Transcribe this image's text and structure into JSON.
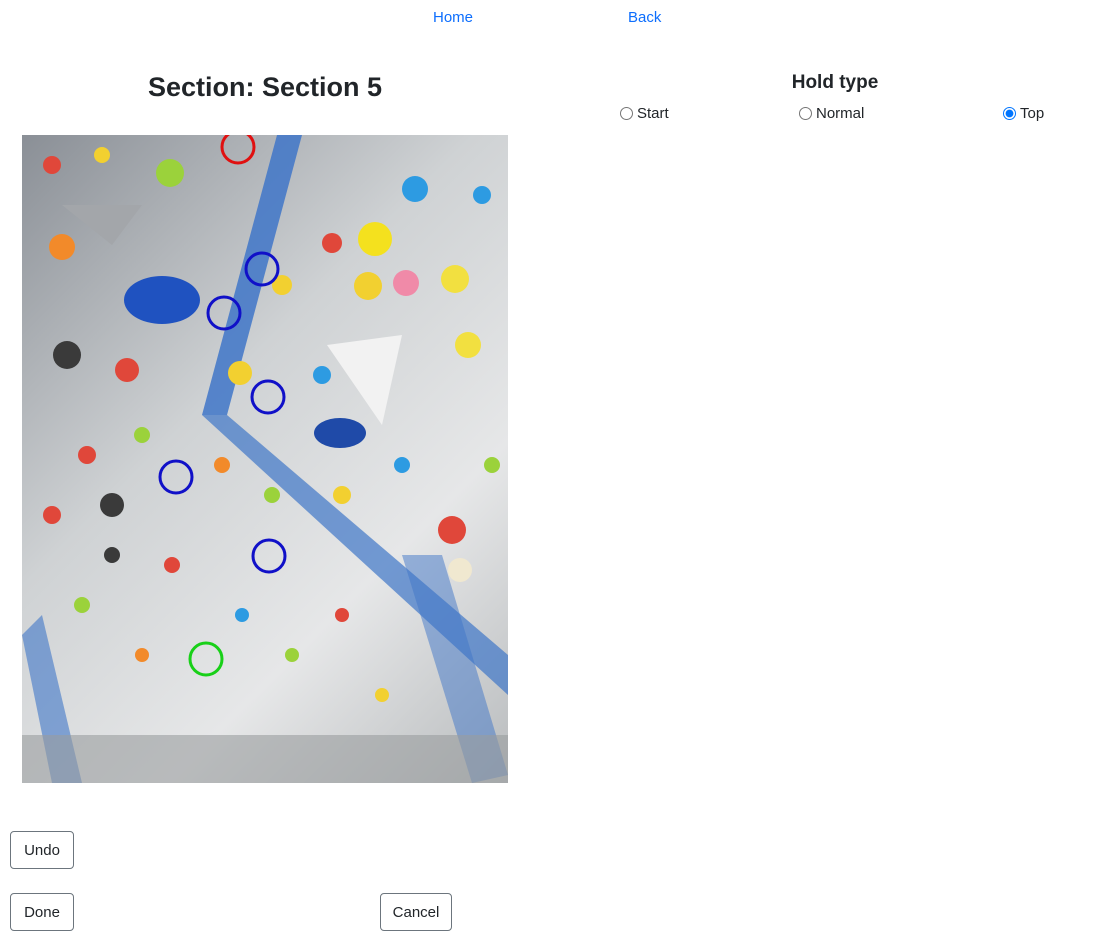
{
  "nav": {
    "home": "Home",
    "back": "Back"
  },
  "section_title": "Section: Section 5",
  "hold_type": {
    "title": "Hold type",
    "options": [
      {
        "label": "Start",
        "checked": false
      },
      {
        "label": "Normal",
        "checked": false
      },
      {
        "label": "Top",
        "checked": true
      }
    ]
  },
  "wall_image": {
    "markers": [
      {
        "role": "top",
        "color": "#e01010"
      },
      {
        "role": "normal",
        "color": "#1010c8"
      },
      {
        "role": "normal",
        "color": "#1010c8"
      },
      {
        "role": "normal",
        "color": "#1010c8"
      },
      {
        "role": "normal",
        "color": "#1010c8"
      },
      {
        "role": "normal",
        "color": "#1010c8"
      },
      {
        "role": "start",
        "color": "#18d018"
      }
    ]
  },
  "buttons": {
    "undo": "Undo",
    "done": "Done",
    "cancel": "Cancel"
  }
}
